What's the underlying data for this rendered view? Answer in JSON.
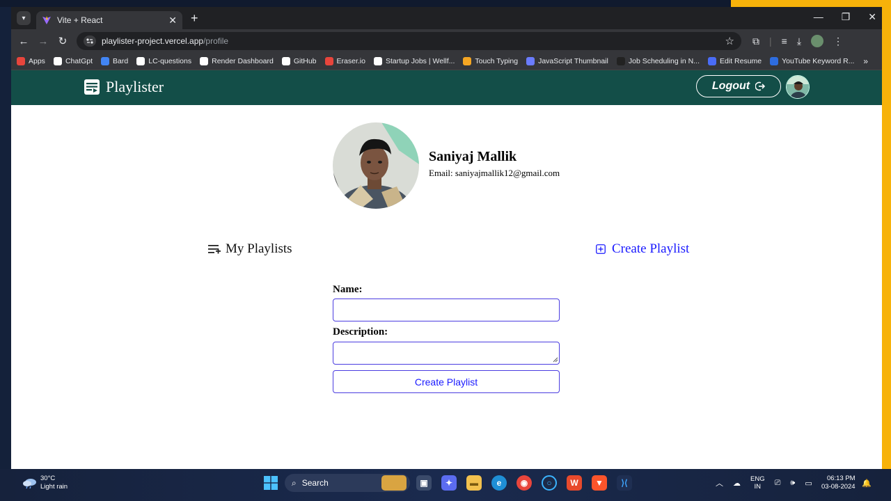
{
  "browser": {
    "tab_title": "Vite + React",
    "url_host": "playlister-project.vercel.app",
    "url_path": "/profile",
    "bookmarks": [
      {
        "label": "Apps",
        "icon": "apps-grid-icon",
        "color": "#e8453c"
      },
      {
        "label": "ChatGpt",
        "icon": "chatgpt-icon",
        "color": "#ffffff"
      },
      {
        "label": "Bard",
        "icon": "bard-sparkle-icon",
        "color": "#4285f4"
      },
      {
        "label": "LC-questions",
        "icon": "github-icon",
        "color": "#ffffff"
      },
      {
        "label": "Render Dashboard",
        "icon": "render-icon",
        "color": "#ffffff"
      },
      {
        "label": "GitHub",
        "icon": "github-icon",
        "color": "#ffffff"
      },
      {
        "label": "Eraser.io",
        "icon": "eraser-icon",
        "color": "#e8453c"
      },
      {
        "label": "Startup Jobs | Wellf...",
        "icon": "wellfound-icon",
        "color": "#ffffff"
      },
      {
        "label": "Touch Typing",
        "icon": "typing-icon",
        "color": "#f5a623"
      },
      {
        "label": "JavaScript Thumbnail",
        "icon": "heart-icon",
        "color": "#6a7cff"
      },
      {
        "label": "Job Scheduling in N...",
        "icon": "job-icon",
        "color": "#222222"
      },
      {
        "label": "Edit Resume",
        "icon": "resume-icon",
        "color": "#4a6cf7"
      },
      {
        "label": "YouTube Keyword R...",
        "icon": "youtube-keyword-icon",
        "color": "#2d6cdf"
      }
    ],
    "bookmarks_overflow": "»"
  },
  "app": {
    "brand": "Playlister",
    "logout_label": "Logout",
    "header_color": "#134e48"
  },
  "profile": {
    "name": "Saniyaj Mallik",
    "email": "Email: saniyajmallik12@gmail.com"
  },
  "playlists": {
    "my_playlists_label": "My Playlists",
    "create_link_label": "Create Playlist"
  },
  "form": {
    "name_label": "Name:",
    "name_value": "",
    "description_label": "Description:",
    "description_value": "",
    "submit_label": "Create Playlist",
    "accent_color": "#4a3ce0"
  },
  "taskbar": {
    "temperature": "30°C",
    "weather": "Light rain",
    "search_placeholder": "Search",
    "lang_top": "ENG",
    "lang_bottom": "IN",
    "time": "06:13 PM",
    "date": "03-08-2024"
  }
}
